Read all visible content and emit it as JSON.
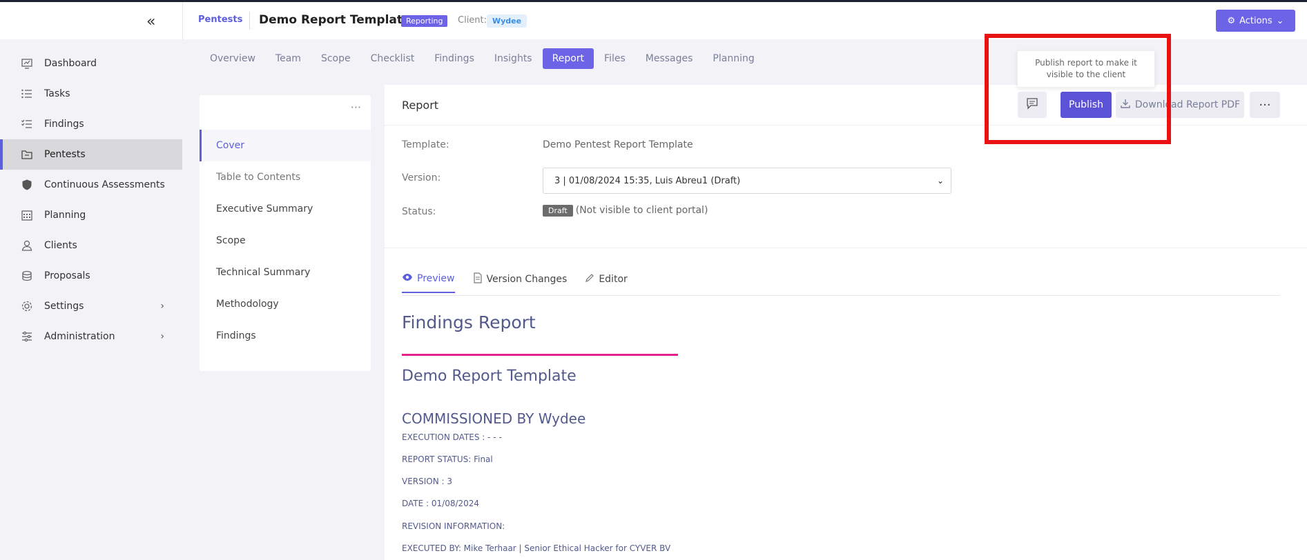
{
  "header": {
    "breadcrumb": "Pentests",
    "title": "Demo Report Template",
    "status_badge": "Reporting",
    "client_label": "Client:",
    "client_name": "Wydee",
    "actions_label": "Actions"
  },
  "sidebar": {
    "items": [
      {
        "label": "Dashboard",
        "icon": "dashboard-icon"
      },
      {
        "label": "Tasks",
        "icon": "tasks-icon"
      },
      {
        "label": "Findings",
        "icon": "findings-icon"
      },
      {
        "label": "Pentests",
        "icon": "pentests-icon",
        "active": true
      },
      {
        "label": "Continuous Assessments",
        "icon": "shield-icon"
      },
      {
        "label": "Planning",
        "icon": "calendar-icon"
      },
      {
        "label": "Clients",
        "icon": "clients-icon"
      },
      {
        "label": "Proposals",
        "icon": "proposals-icon"
      },
      {
        "label": "Settings",
        "icon": "gear-icon"
      },
      {
        "label": "Administration",
        "icon": "sliders-icon"
      }
    ]
  },
  "tabs": [
    "Overview",
    "Team",
    "Scope",
    "Checklist",
    "Findings",
    "Insights",
    "Report",
    "Files",
    "Messages",
    "Planning"
  ],
  "active_tab": "Report",
  "outline": {
    "items": [
      "Cover",
      "Table to Contents",
      "Executive Summary",
      "Scope",
      "Technical Summary",
      "Methodology",
      "Findings"
    ]
  },
  "report": {
    "heading": "Report",
    "template_label": "Template:",
    "template_value": "Demo Pentest Report Template",
    "version_label": "Version:",
    "version_value": "3 | 01/08/2024 15:35, Luis Abreu1 (Draft)",
    "status_label": "Status:",
    "status_badge": "Draft",
    "status_note": "(Not visible to client portal)",
    "buttons": {
      "publish": "Publish",
      "download": "Download Report PDF",
      "more": "···"
    },
    "tooltip": "Publish report to make it visible to the client",
    "subtabs": [
      "Preview",
      "Version Changes",
      "Editor"
    ],
    "preview": {
      "title": "Findings Report",
      "subtitle": "Demo Report Template",
      "commissioned": "COMMISSIONED BY Wydee",
      "lines": [
        "EXECUTION DATES : - - -",
        "REPORT STATUS: Final",
        "VERSION : 3",
        "DATE : 01/08/2024",
        "REVISION INFORMATION:",
        "EXECUTED BY: Mike Terhaar | Senior Ethical Hacker for CYVER BV"
      ]
    }
  },
  "colors": {
    "accent": "#6c63e6",
    "highlight": "#e81212",
    "rule": "#e6218b"
  }
}
